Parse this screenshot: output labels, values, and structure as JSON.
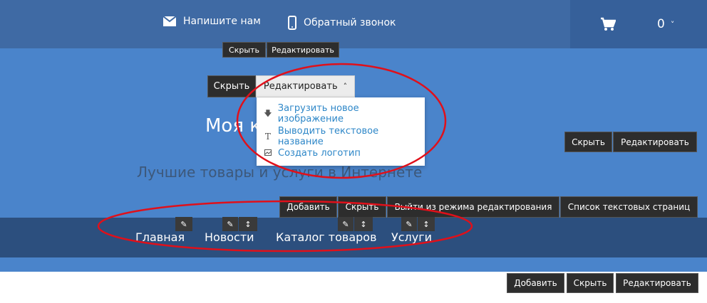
{
  "header": {
    "write_us": "Напишите нам",
    "callback": "Обратный звонок",
    "cart_count": "0"
  },
  "logo_controls": {
    "hide": "Скрыть",
    "edit": "Редактировать"
  },
  "logo_menu": {
    "hide": "Скрыть",
    "edit": "Редактировать",
    "items": [
      {
        "label": "Загрузить новое изображение",
        "icon": "download-icon"
      },
      {
        "label": "Выводить текстовое название",
        "icon": "text-icon"
      },
      {
        "label": "Создать логотип",
        "icon": "image-icon"
      }
    ]
  },
  "site": {
    "title": "Моя к",
    "slogan": "Лучшие товары и услуги в Интернете"
  },
  "hero_controls": {
    "hide": "Скрыть",
    "edit": "Редактировать"
  },
  "menu_toolbar": {
    "add": "Добавить",
    "hide": "Скрыть",
    "exit_edit": "Выйти из режима редактирования",
    "text_pages": "Список текстовых страниц"
  },
  "nav": {
    "items": [
      {
        "label": "Главная"
      },
      {
        "label": "Новости"
      },
      {
        "label": "Каталог товаров"
      },
      {
        "label": "Услуги"
      }
    ]
  },
  "footer_controls": {
    "add": "Добавить",
    "hide": "Скрыть",
    "edit": "Редактировать"
  },
  "colors": {
    "topbar": "#3f6aa4",
    "hero": "#4a84cb",
    "navbar": "#2c4f7e",
    "annotation": "#e0101a",
    "link": "#2e87c8"
  }
}
